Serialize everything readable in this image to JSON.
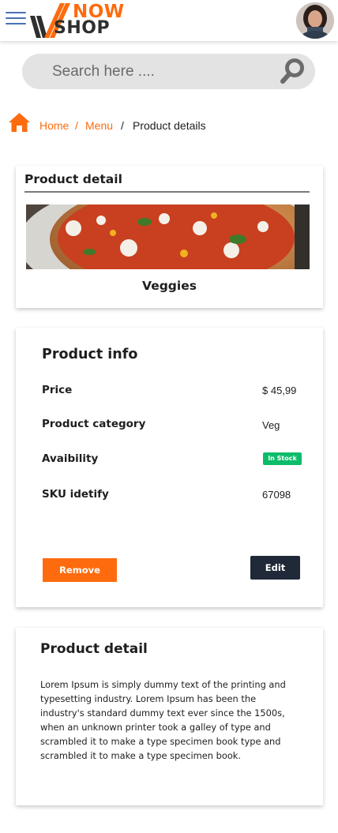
{
  "header": {
    "logo_top": "NOW",
    "logo_bottom": "SHOP",
    "brand_color": "#fe6b0e",
    "menu_icon": "hamburger-icon",
    "avatar_icon": "user-avatar"
  },
  "search": {
    "placeholder": "Search here ....",
    "value": "",
    "icon": "search-icon"
  },
  "breadcrumb": {
    "home": "Home",
    "sep1": "/",
    "menu": "Menu",
    "sep2": "/",
    "current": "Product details",
    "icon": "home-icon"
  },
  "product_card": {
    "title": "Product detail",
    "image_alt": "pizza-image",
    "name": "Veggies"
  },
  "info_card": {
    "title": "Product info",
    "rows": [
      {
        "label": "Price",
        "value": "$ 45,99"
      },
      {
        "label": "Product category",
        "value": "Veg"
      },
      {
        "label": "Avaibility",
        "value": "In Stock"
      },
      {
        "label": "SKU idetify",
        "value": "67098"
      }
    ],
    "stock_color": "#0dbc6a",
    "remove_label": "Remove",
    "edit_label": "Edit"
  },
  "description_card": {
    "title": "Product detail",
    "body": "Lorem Ipsum is simply dummy text of the printing and typesetting industry. Lorem Ipsum has been the industry's standard dummy text ever since the 1500s, when an unknown printer took a galley of type and scrambled it to make a type specimen book type and scrambled it to make a type specimen book."
  }
}
